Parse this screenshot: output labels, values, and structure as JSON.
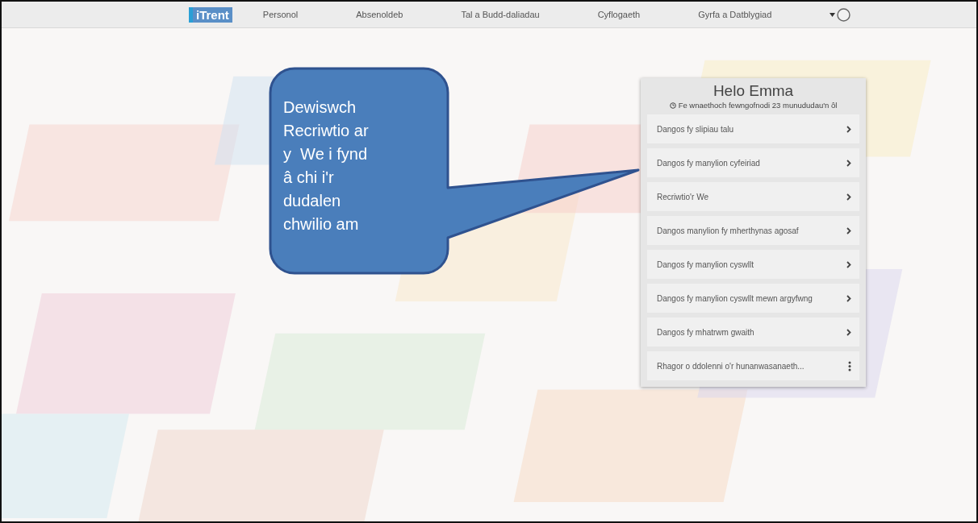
{
  "nav": {
    "logo": "iTrent",
    "items": [
      {
        "label": "Personol"
      },
      {
        "label": "Absenoldeb"
      },
      {
        "label": "Tal a Budd-daliadau"
      },
      {
        "label": "Cyflogaeth"
      },
      {
        "label": "Gyrfa a Datblygiad"
      }
    ]
  },
  "welcome_card": {
    "title": "Helo Emma",
    "last_login": "Fe wnaethoch fewngofnodi 23 munududau'n ôl",
    "links": [
      {
        "kind": "link",
        "label": "Dangos fy slipiau talu"
      },
      {
        "kind": "link",
        "label": "Dangos fy manylion cyfeiriad"
      },
      {
        "kind": "link",
        "label": "Recriwtio'r We"
      },
      {
        "kind": "link",
        "label": "Dangos manylion fy mherthynas agosaf"
      },
      {
        "kind": "link",
        "label": "Dangos fy manylion cyswllt"
      },
      {
        "kind": "link",
        "label": "Dangos fy manylion cyswllt mewn argyfwng"
      },
      {
        "kind": "link",
        "label": "Dangos fy mhatrwm gwaith"
      },
      {
        "kind": "more",
        "label": "Rhagor o ddolenni o'r hunanwasanaeth..."
      }
    ]
  },
  "callout": {
    "text": "Dewiswch\nRecriwtio ar\ny  We i fynd\nâ chi i'r\ndudalen\nchwilio am"
  }
}
